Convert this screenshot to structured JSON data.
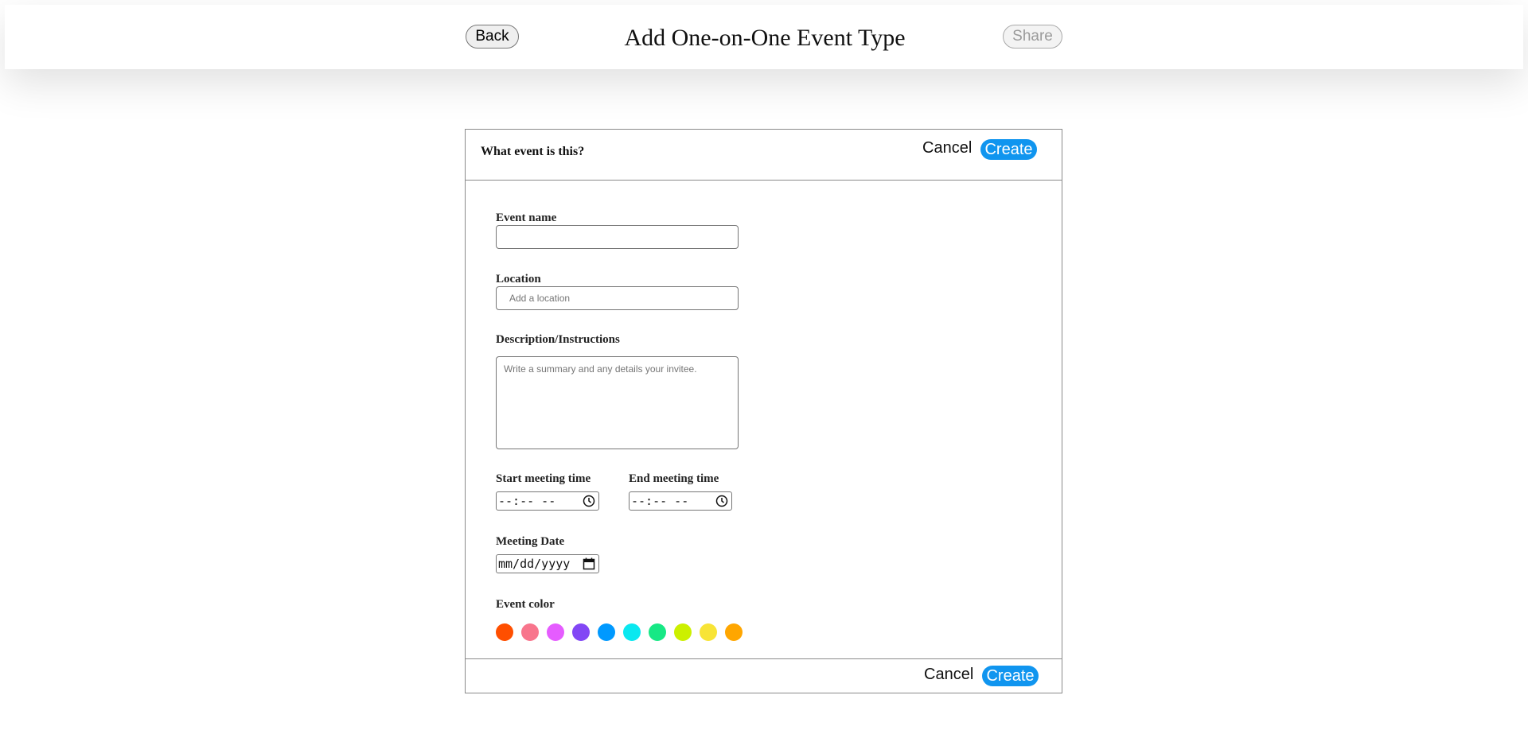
{
  "header": {
    "back_label": "Back",
    "title": "Add One-on-One Event Type",
    "share_label": "Share"
  },
  "card": {
    "question": "What event is this?",
    "cancel_label": "Cancel",
    "create_label": "Create",
    "fields": {
      "event_name_label": "Event name",
      "event_name_value": "",
      "location_label": "Location",
      "location_placeholder": "Add a location",
      "description_label": "Description/Instructions",
      "description_placeholder": "Write a summary and any details your invitee.",
      "start_time_label": "Start meeting time",
      "start_time_placeholder": "--:-- --",
      "end_time_label": "End meeting time",
      "end_time_placeholder": "--:-- --",
      "date_label": "Meeting Date",
      "date_placeholder": "mm/dd/yyyy",
      "color_label": "Event color"
    },
    "colors": [
      "#ff4f00",
      "#f8758c",
      "#e55cff",
      "#8247f5",
      "#0099ff",
      "#0ae8f0",
      "#17e885",
      "#ccf000",
      "#f8e436",
      "#ffa600"
    ],
    "footer": {
      "cancel_label": "Cancel",
      "create_label": "Create"
    }
  }
}
